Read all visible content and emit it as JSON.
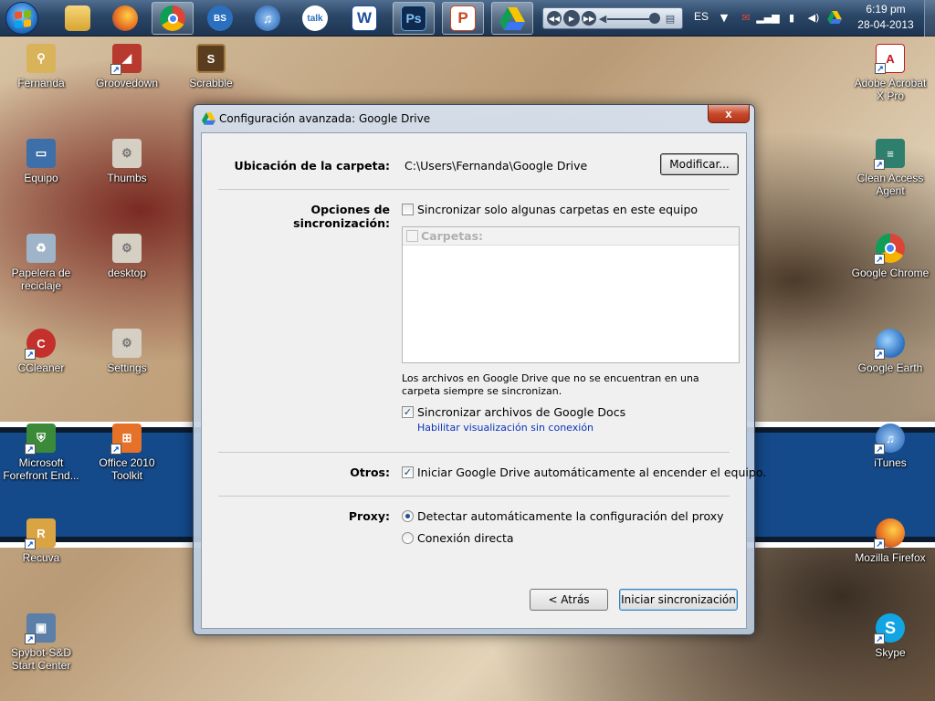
{
  "taskbar": {
    "apps": [
      {
        "name": "explorer",
        "glyph": ""
      },
      {
        "name": "firefox",
        "glyph": ""
      },
      {
        "name": "chrome",
        "glyph": ""
      },
      {
        "name": "bs-player",
        "glyph": "BS"
      },
      {
        "name": "itunes",
        "glyph": "♫"
      },
      {
        "name": "google-talk",
        "glyph": "talk"
      },
      {
        "name": "word",
        "glyph": "W"
      },
      {
        "name": "photoshop",
        "glyph": "Ps"
      },
      {
        "name": "powerpoint",
        "glyph": "P"
      },
      {
        "name": "google-drive",
        "glyph": ""
      }
    ],
    "language": "ES",
    "time": "6:19 pm",
    "date": "28-04-2013"
  },
  "desktop": {
    "left_icons": [
      {
        "label": "Fernanda",
        "icon": "user-folder-icon",
        "color": "#d9b35a"
      },
      {
        "label": "Groovedown",
        "icon": "groovedown-icon",
        "color": "#b83a2e"
      },
      {
        "label": "Scrabble",
        "icon": "scrabble-icon",
        "color": "#5a3d1e"
      },
      {
        "label": "Equipo",
        "icon": "computer-icon",
        "color": "#3d6fa8"
      },
      {
        "label": "Thumbs",
        "icon": "thumbs-file-icon",
        "color": "#d6cfc4"
      },
      {
        "label": "Papelera de reciclaje",
        "icon": "recycle-bin-icon",
        "color": "#9fb4c8"
      },
      {
        "label": "desktop",
        "icon": "desktop-ini-icon",
        "color": "#d6cfc4"
      },
      {
        "label": "CCleaner",
        "icon": "ccleaner-icon",
        "color": "#c4302b"
      },
      {
        "label": "Settings",
        "icon": "settings-file-icon",
        "color": "#d6cfc4"
      },
      {
        "label": "Microsoft Forefront End...",
        "icon": "forefront-icon",
        "color": "#3a8a3a"
      },
      {
        "label": "Office 2010 Toolkit",
        "icon": "office-toolkit-icon",
        "color": "#e6722a"
      },
      {
        "label": "Recuva",
        "icon": "recuva-icon",
        "color": "#d9a441"
      },
      {
        "label": "Spybot-S&D Start Center",
        "icon": "spybot-icon",
        "color": "#5b7fa8"
      }
    ],
    "right_icons": [
      {
        "label": "Adobe Acrobat X Pro",
        "icon": "acrobat-icon",
        "color": "#c8161d"
      },
      {
        "label": "Clean Access Agent",
        "icon": "cisco-agent-icon",
        "color": "#2f7f6f"
      },
      {
        "label": "Google Chrome",
        "icon": "chrome-icon",
        "color": "#d93b2b"
      },
      {
        "label": "Google Earth",
        "icon": "google-earth-icon",
        "color": "#2b6fbf"
      },
      {
        "label": "iTunes",
        "icon": "itunes-icon",
        "color": "#2b6fbf"
      },
      {
        "label": "Mozilla Firefox",
        "icon": "firefox-icon",
        "color": "#e66a1f"
      },
      {
        "label": "Skype",
        "icon": "skype-icon",
        "color": "#12a5e3"
      }
    ]
  },
  "dialog": {
    "title": "Configuración avanzada: Google Drive",
    "close_label": "x",
    "folder_location": {
      "label": "Ubicación de la carpeta:",
      "path": "C:\\Users\\Fernanda\\Google Drive",
      "button": "Modificar..."
    },
    "sync_options": {
      "label": "Opciones de sincronización:",
      "selective_sync": {
        "label": "Sincronizar solo algunas carpetas en este equipo",
        "checked": false
      },
      "folders_header": "Carpetas:",
      "note": "Los archivos en Google Drive que no se encuentran en una carpeta siempre se sincronizan.",
      "sync_docs": {
        "label": "Sincronizar archivos de Google Docs",
        "checked": true
      },
      "offline_link": "Habilitar visualización sin conexión"
    },
    "others": {
      "label": "Otros:",
      "autostart": {
        "label": "Iniciar Google Drive automáticamente al encender el equipo.",
        "checked": true
      }
    },
    "proxy": {
      "label": "Proxy:",
      "options": [
        {
          "label": "Detectar automáticamente la configuración del proxy",
          "selected": true
        },
        {
          "label": "Conexión directa",
          "selected": false
        }
      ]
    },
    "buttons": {
      "back": "< Atrás",
      "start": "Iniciar sincronización"
    }
  }
}
